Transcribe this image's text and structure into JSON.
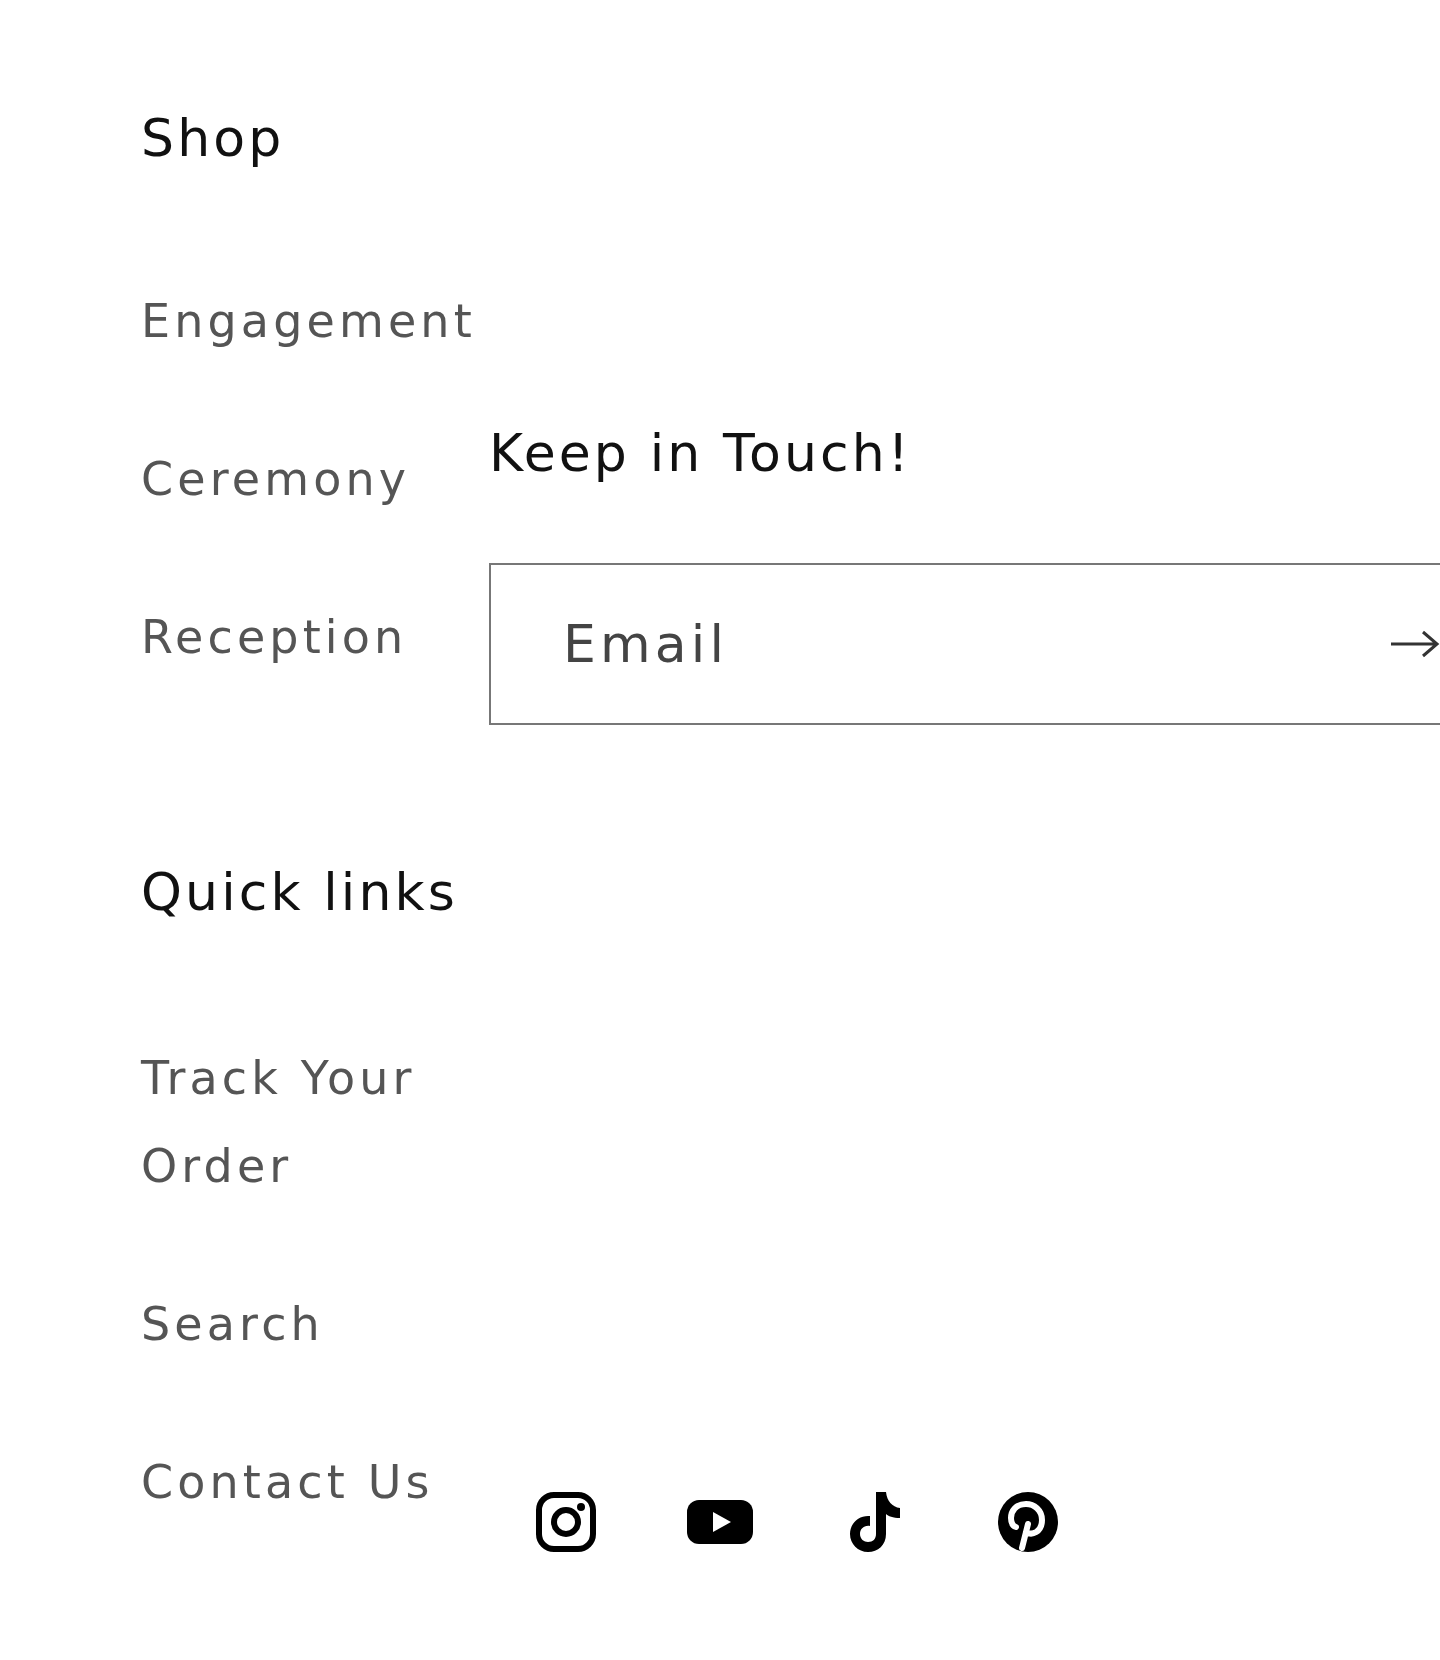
{
  "menus": [
    {
      "heading": "Shop",
      "links": [
        "Engagement",
        "Ceremony",
        "Reception"
      ]
    },
    {
      "heading": "Quick links",
      "links": [
        "Track Your Order",
        "Search",
        "Contact Us"
      ]
    }
  ],
  "newsletter": {
    "heading": "Keep in Touch!",
    "email": {
      "placeholder": "Email"
    }
  },
  "social": [
    {
      "kind": "instagram"
    },
    {
      "kind": "youtube"
    },
    {
      "kind": "tiktok"
    },
    {
      "kind": "pinterest"
    }
  ]
}
